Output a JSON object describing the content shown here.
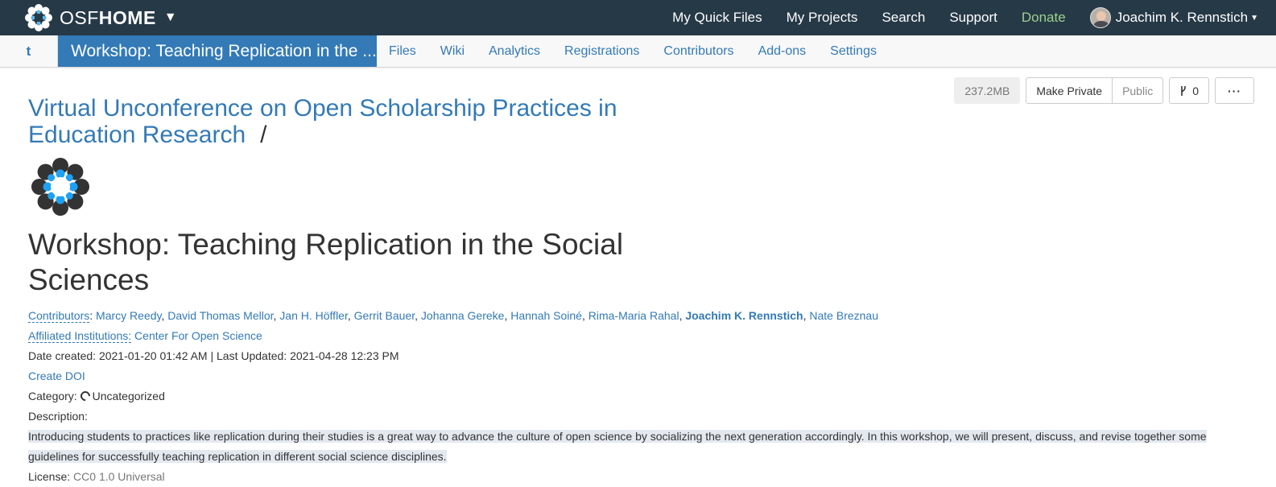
{
  "topnav": {
    "brand_osf": "OSF",
    "brand_home": "HOME",
    "links": [
      "My Quick Files",
      "My Projects",
      "Search",
      "Support"
    ],
    "donate": "Donate",
    "user_name": "Joachim K. Rennstich"
  },
  "subnav": {
    "parent_label": "t",
    "project_tab": "Workshop: Teaching Replication in the ...",
    "links": [
      "Files",
      "Wiki",
      "Analytics",
      "Registrations",
      "Contributors",
      "Add-ons",
      "Settings"
    ]
  },
  "toolbar": {
    "size": "237.2MB",
    "make_private": "Make Private",
    "public": "Public",
    "fork_count": "0",
    "more": "···"
  },
  "parent_project": {
    "title": "Virtual Unconference on Open Scholarship Practices in Education Research",
    "slash": "/"
  },
  "project": {
    "title": "Workshop: Teaching Replication in the Social Sciences",
    "contributors_label": "Contributors",
    "contributors": [
      "Marcy Reedy",
      "David Thomas Mellor",
      "Jan H. Höffler",
      "Gerrit Bauer",
      "Johanna Gereke",
      "Hannah Soiné",
      "Rima-Maria Rahal",
      "Joachim K. Rennstich",
      "Nate Breznau"
    ],
    "affiliated_label": "Affiliated Institutions:",
    "affiliated_value": "Center For Open Science",
    "date_created": "Date created: 2021-01-20 01:42 AM | Last Updated: 2021-04-28 12:23 PM",
    "create_doi": "Create DOI",
    "category_label": "Category:",
    "category_value": "Uncategorized",
    "description_label": "Description:",
    "description": "Introducing students to practices like replication during their studies is a great way to advance the culture of open science by socializing the next generation accordingly. In this workshop, we will present, discuss, and revise together some guidelines for successfully teaching replication in different social science disciplines.",
    "license_label": "License:",
    "license_value": "CC0 1.0 Universal"
  }
}
